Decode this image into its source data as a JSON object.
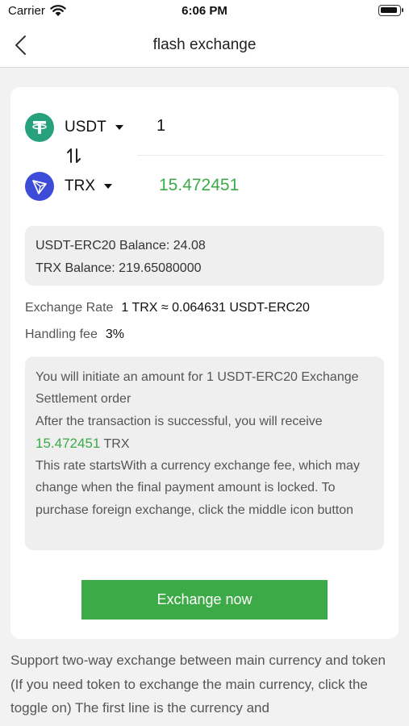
{
  "status_bar": {
    "carrier": "Carrier",
    "time": "6:06 PM"
  },
  "nav": {
    "title": "flash exchange"
  },
  "from_coin": {
    "symbol": "USDT",
    "amount": "1",
    "color": "#26a17b",
    "icon": "tether-icon"
  },
  "to_coin": {
    "symbol": "TRX",
    "amount": "15.472451",
    "color": "#3c4bd8",
    "icon": "tron-icon"
  },
  "balances": {
    "usdt_label": "USDT-ERC20 Balance:",
    "usdt_value": "24.08",
    "trx_label": "TRX Balance:",
    "trx_value": "219.65080000"
  },
  "rate": {
    "label": "Exchange Rate",
    "value": "1 TRX ≈ 0.064631 USDT-ERC20"
  },
  "fee": {
    "label": "Handling fee",
    "value": "3%"
  },
  "notice": {
    "line1": "You will initiate an amount for 1 USDT-ERC20 Exchange Settlement order",
    "line2": "After the transaction is successful, you will receive",
    "amount": "15.472451",
    "unit": "TRX",
    "line3": "This rate startsWith a currency exchange fee, which may change when the final payment amount is locked. To purchase foreign exchange, click the middle icon button"
  },
  "button": {
    "label": "Exchange now",
    "color": "#3cab47"
  },
  "footer": {
    "text": "Support two-way exchange between main currency and token (If you need token to exchange the main currency, click the toggle on) The first line is the currency and"
  }
}
